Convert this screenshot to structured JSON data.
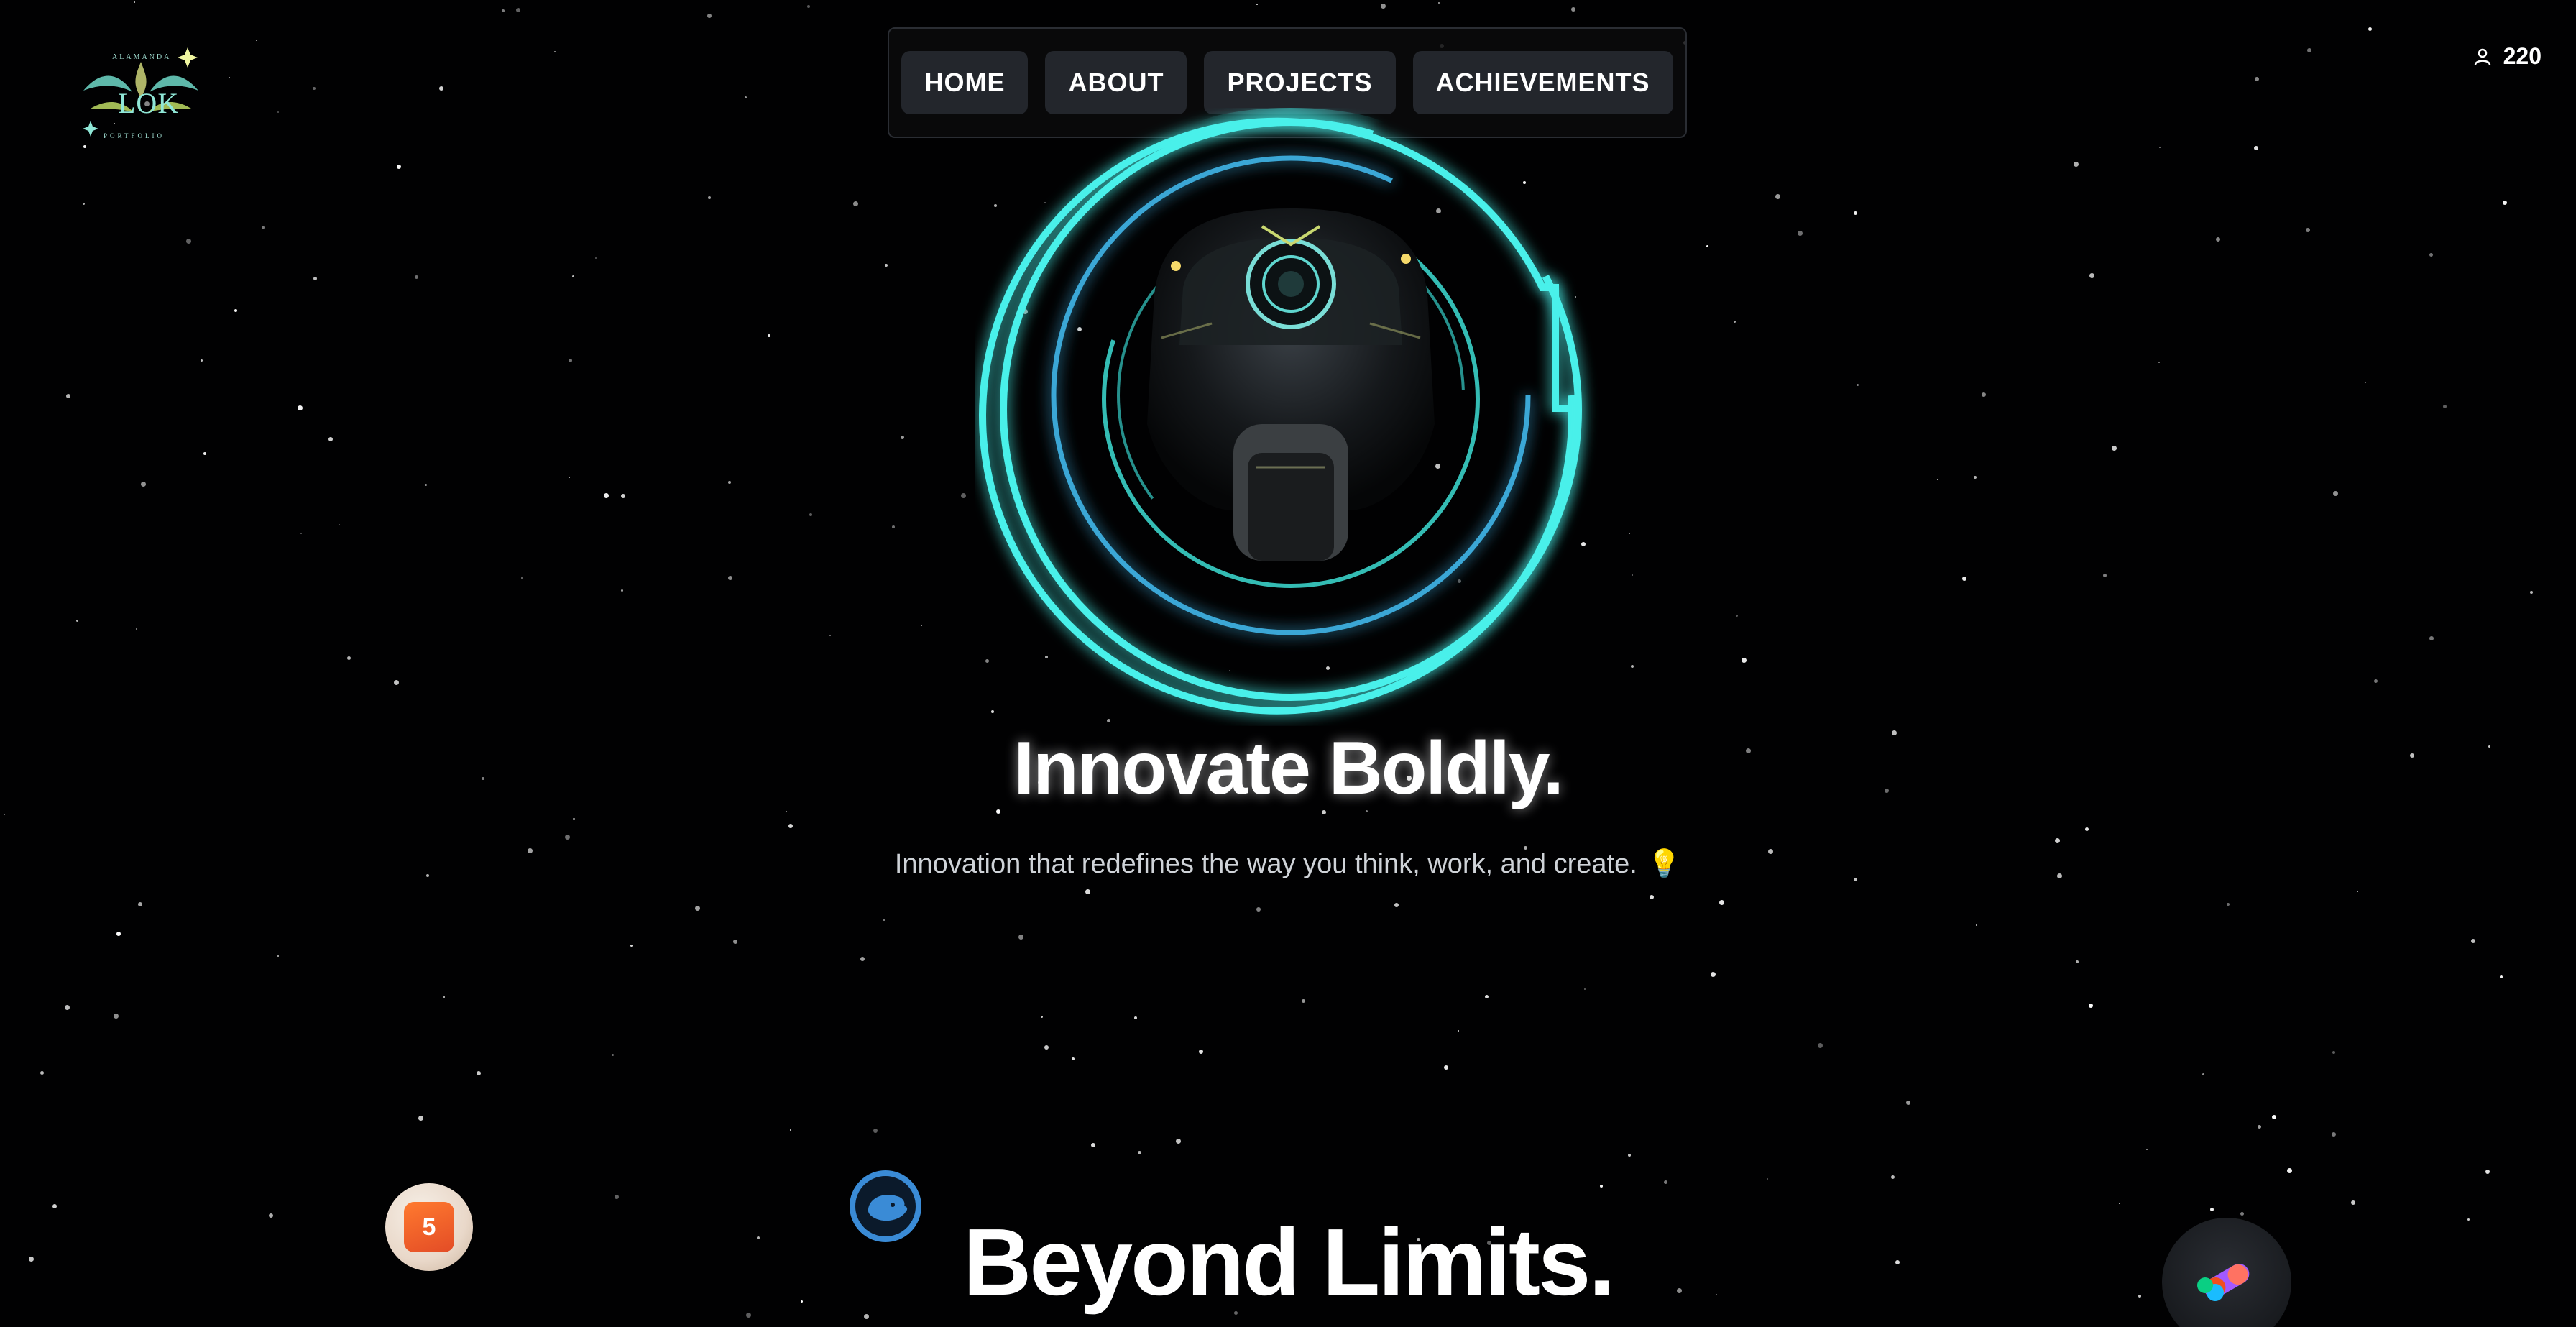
{
  "logo": {
    "top_text": "ALAMANDA",
    "name": "LOK",
    "sub_text": "PORTFOLIO"
  },
  "nav": {
    "items": [
      {
        "label": "HOME"
      },
      {
        "label": "ABOUT"
      },
      {
        "label": "PROJECTS"
      },
      {
        "label": "ACHIEVEMENTS"
      }
    ]
  },
  "visitors": {
    "icon": "user-icon",
    "count": "220"
  },
  "hero": {
    "headline": "Innovate Boldly.",
    "subtitle": "Innovation that redefines the way you think, work, and create.",
    "subtitle_icon": "💡",
    "second_headline": "Beyond Limits."
  },
  "floating_icons": [
    "html5-icon",
    "docker-icon",
    "figma-icon"
  ],
  "colors": {
    "background": "#000000",
    "accent_cyan": "#3ee6e0",
    "nav_button": "#23262c"
  }
}
